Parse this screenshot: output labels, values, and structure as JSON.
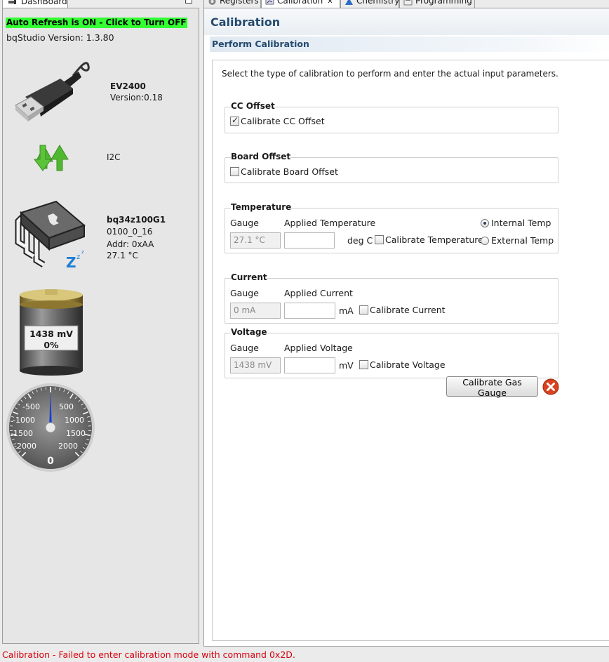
{
  "dashboard": {
    "tab_label": "DashBoard",
    "auto_refresh": "Auto Refresh is ON - Click to Turn OFF",
    "studio_version": "bqStudio Version:  1.3.80",
    "adapter": {
      "name": "EV2400",
      "version": "Version:0.18"
    },
    "bus": "I2C",
    "device": {
      "name": "bq34z100G1",
      "fw": "0100_0_16",
      "addr": "Addr: 0xAA",
      "temp": "27.1 °C"
    },
    "battery": {
      "voltage": "1438 mV",
      "soc": "0%",
      "soc_fraction": 0.0
    },
    "current_gauge": {
      "value": 0,
      "display": "0",
      "ticks": [
        "-500",
        "500",
        "-1000",
        "1000",
        "-1500",
        "1500",
        "-2000",
        "2000"
      ],
      "needle_color": "#1a3fd6"
    }
  },
  "tabs": [
    {
      "label": "Registers",
      "icon": "gear-icon"
    },
    {
      "label": "Calibration",
      "icon": "calibration-icon",
      "active": true,
      "close": "✕"
    },
    {
      "label": "Chemistry",
      "icon": "chemistry-icon"
    },
    {
      "label": "Programming",
      "icon": "programming-icon"
    }
  ],
  "calibration": {
    "title": "Calibration",
    "section": "Perform Calibration",
    "instruction": "Select the type of calibration to perform and enter the actual input parameters.",
    "cc_offset": {
      "title": "CC Offset",
      "checkbox": "Calibrate CC Offset",
      "checked": true
    },
    "board_offset": {
      "title": "Board Offset",
      "checkbox": "Calibrate Board Offset",
      "checked": false
    },
    "temperature": {
      "title": "Temperature",
      "gauge_label": "Gauge",
      "applied_label": "Applied Temperature",
      "gauge_value": "27.1 °C",
      "applied_value": "",
      "unit": "deg C",
      "checkbox": "Calibrate Temperature",
      "checked": false,
      "radio_internal": "Internal Temp",
      "radio_external": "External Temp",
      "selected": "internal"
    },
    "current": {
      "title": "Current",
      "gauge_label": "Gauge",
      "applied_label": "Applied Current",
      "gauge_value": "0 mA",
      "applied_value": "",
      "unit": "mA",
      "checkbox": "Calibrate Current",
      "checked": false
    },
    "voltage": {
      "title": "Voltage",
      "gauge_label": "Gauge",
      "applied_label": "Applied Voltage",
      "gauge_value": "1438 mV",
      "applied_value": "",
      "unit": "mV",
      "checkbox": "Calibrate Voltage",
      "checked": false
    },
    "calibrate_button": "Calibrate Gas Gauge",
    "cancel_icon": "cancel-icon"
  },
  "status": "Calibration - Failed to enter calibration mode with command 0x2D.",
  "colors": {
    "auto_refresh_bg": "#33ff33",
    "title_blue": "#244a6e",
    "error_red": "#d8000c",
    "cancel_red": "#d9421f"
  }
}
